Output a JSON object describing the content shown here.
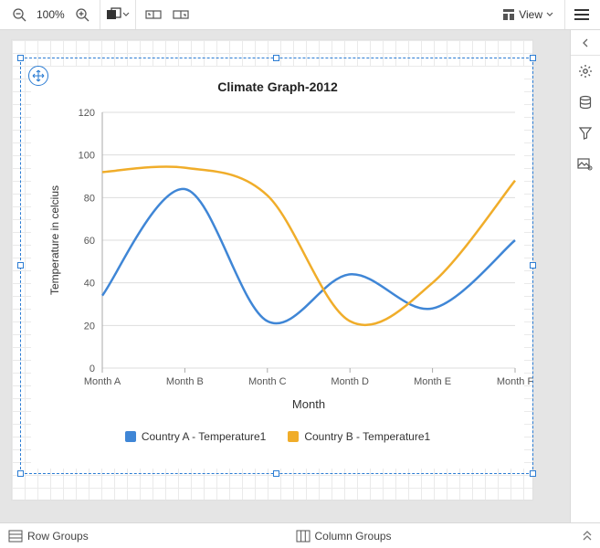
{
  "toolbar": {
    "zoom_value": "100%",
    "view_label": "View"
  },
  "bottombar": {
    "row_groups_label": "Row Groups",
    "column_groups_label": "Column Groups"
  },
  "chart": {
    "title": "Climate Graph-2012",
    "xlabel": "Month",
    "ylabel": "Temperature in celcius",
    "legend": [
      {
        "name": "Country A - Temperature1",
        "color": "#3f86d6"
      },
      {
        "name": "Country B - Temperature1",
        "color": "#f0ad2a"
      }
    ]
  },
  "chart_data": {
    "type": "line",
    "categories": [
      "Month A",
      "Month B",
      "Month C",
      "Month D",
      "Month E",
      "Month F"
    ],
    "ylim": [
      0,
      120
    ],
    "yticks": [
      0,
      20,
      40,
      60,
      80,
      100,
      120
    ],
    "series": [
      {
        "name": "Country A - Temperature1",
        "color": "#3f86d6",
        "values": [
          34,
          84,
          22,
          44,
          28,
          60
        ]
      },
      {
        "name": "Country B - Temperature1",
        "color": "#f0ad2a",
        "values": [
          92,
          94,
          81,
          22,
          40,
          88
        ]
      }
    ]
  }
}
